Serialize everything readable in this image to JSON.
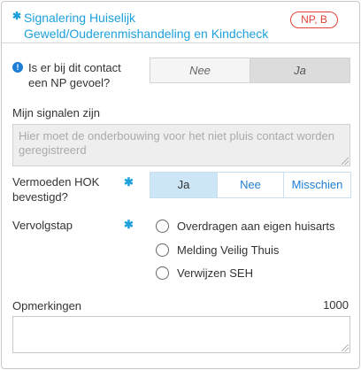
{
  "header": {
    "required_marker": "✱",
    "title": "Signalering Huiselijk Geweld/Ouderenmishandeling en Kindcheck",
    "badge": "NP, B"
  },
  "np_question": {
    "info_icon": "!",
    "label": "Is er bij dit contact een NP gevoel?",
    "options": [
      "Nee",
      "Ja"
    ],
    "selected": "Ja"
  },
  "signals": {
    "label": "Mijn signalen zijn",
    "placeholder": "Hier moet de onderbouwing voor het niet pluis contact worden geregistreerd"
  },
  "hok": {
    "label": "Vermoeden HOK bevestigd?",
    "required_marker": "✱",
    "options": [
      "Ja",
      "Nee",
      "Misschien"
    ],
    "selected": "Ja"
  },
  "next_step": {
    "label": "Vervolgstap",
    "required_marker": "✱",
    "options": [
      "Overdragen aan eigen huisarts",
      "Melding Veilig Thuis",
      "Verwijzen SEH"
    ]
  },
  "remarks": {
    "label": "Opmerkingen",
    "counter": "1000"
  },
  "colors": {
    "accent": "#1ea0dc",
    "badge": "#e0433a",
    "selected_blue": "#cde6f7"
  }
}
